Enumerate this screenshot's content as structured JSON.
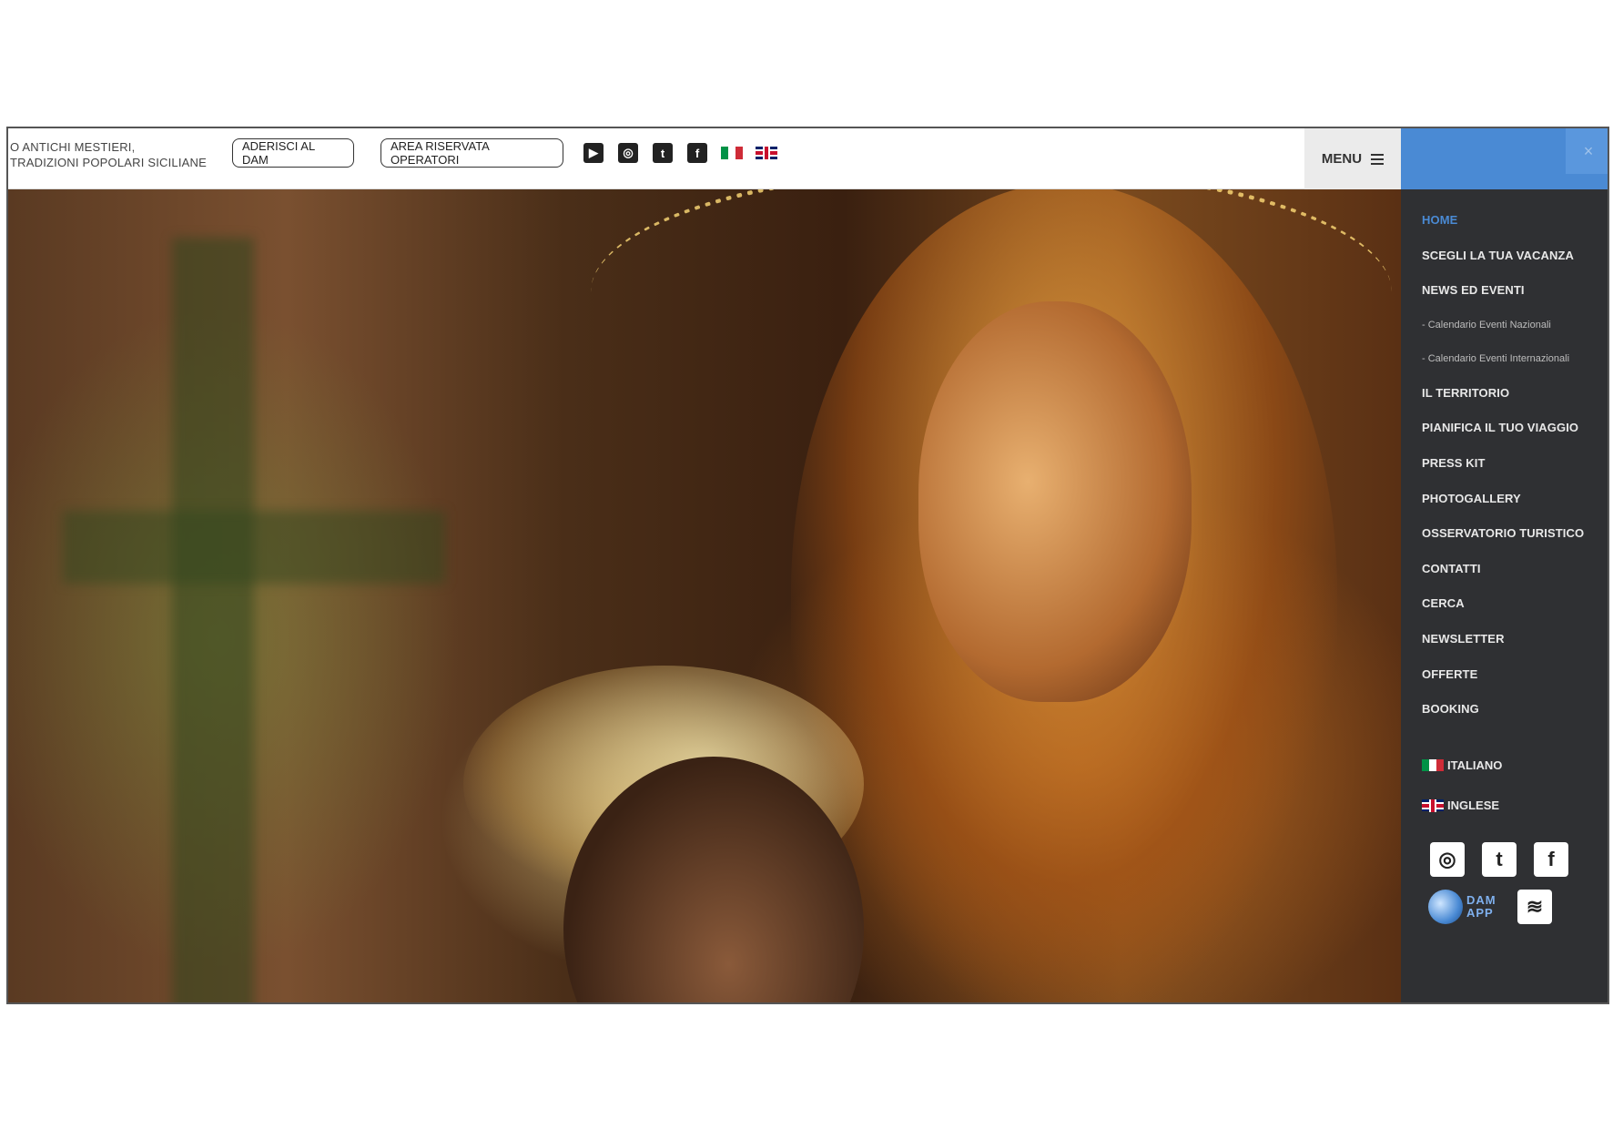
{
  "topbar": {
    "tagline_line1": "O ANTICHI MESTIERI,",
    "tagline_line2": "TRADIZIONI POPOLARI SICILIANE",
    "join_button": "ADERISCI AL DAM",
    "operators_button": "AREA RISERVATA OPERATORI",
    "social": [
      {
        "icon": "youtube-icon",
        "glyph": "▶"
      },
      {
        "icon": "instagram-icon",
        "glyph": "◎"
      },
      {
        "icon": "twitter-icon",
        "glyph": "t"
      },
      {
        "icon": "facebook-icon",
        "glyph": "f"
      }
    ],
    "languages": [
      "italian-flag-icon",
      "uk-flag-icon"
    ],
    "menu_label": "MENU"
  },
  "sidebar": {
    "close_glyph": "×",
    "items": [
      {
        "label": "HOME",
        "active": true
      },
      {
        "label": "SCEGLI LA TUA VACANZA"
      },
      {
        "label": "NEWS ED EVENTI"
      },
      {
        "label": "- Calendario Eventi Nazionali",
        "sub": true
      },
      {
        "label": "- Calendario Eventi Internazionali",
        "sub": true
      },
      {
        "label": "IL TERRITORIO"
      },
      {
        "label": "PIANIFICA IL TUO VIAGGIO"
      },
      {
        "label": "PRESS KIT"
      },
      {
        "label": "PHOTOGALLERY"
      },
      {
        "label": "OSSERVATORIO TURISTICO"
      },
      {
        "label": "CONTATTI"
      },
      {
        "label": "CERCA"
      },
      {
        "label": "NEWSLETTER"
      },
      {
        "label": "OFFERTE"
      },
      {
        "label": "BOOKING"
      }
    ],
    "lang_it": "ITALIANO",
    "lang_en": "INGLESE",
    "social": [
      {
        "icon": "instagram-icon",
        "glyph": "◎"
      },
      {
        "icon": "twitter-icon",
        "glyph": "t"
      },
      {
        "icon": "facebook-icon",
        "glyph": "f"
      },
      {
        "icon": "rss-icon",
        "glyph": "≋"
      }
    ],
    "damapp_line1": "DAM",
    "damapp_line2": "APP"
  },
  "colors": {
    "accent": "#4a8ad4",
    "sidebar_bg": "#2f3033",
    "topbar_bg": "#ffffff"
  }
}
